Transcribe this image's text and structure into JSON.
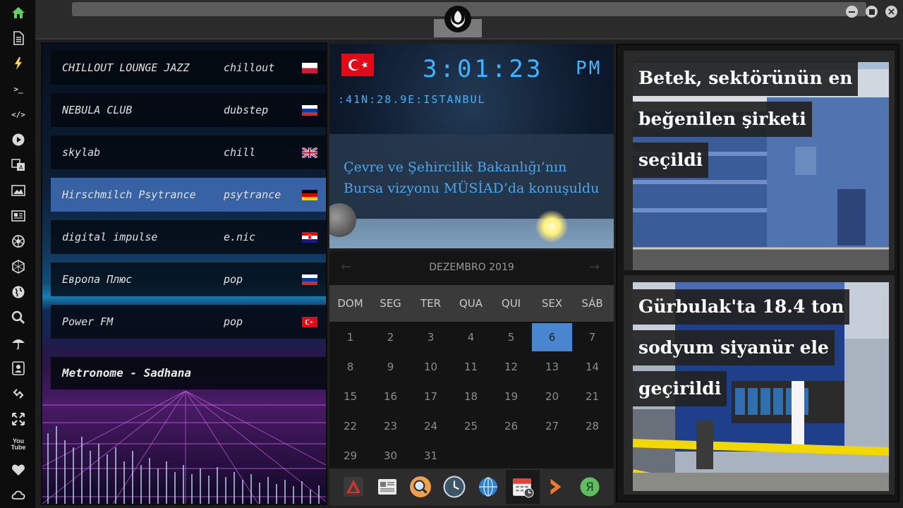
{
  "window": {
    "controls": [
      "minimize",
      "maximize",
      "close"
    ]
  },
  "rail": {
    "items": [
      {
        "name": "home",
        "icon": "home-icon"
      },
      {
        "name": "document",
        "icon": "document-icon"
      },
      {
        "name": "bolt",
        "icon": "bolt-icon"
      },
      {
        "name": "terminal",
        "icon": "terminal-icon",
        "glyph": ">_"
      },
      {
        "name": "code",
        "icon": "code-icon",
        "glyph": "</>"
      },
      {
        "name": "play",
        "icon": "play-icon"
      },
      {
        "name": "translate",
        "icon": "translate-icon"
      },
      {
        "name": "image",
        "icon": "image-icon"
      },
      {
        "name": "news",
        "icon": "newspaper-icon"
      },
      {
        "name": "aperture",
        "icon": "aperture-icon"
      },
      {
        "name": "hexagon",
        "icon": "hexagon-icon"
      },
      {
        "name": "globe",
        "icon": "globe-icon"
      },
      {
        "name": "search",
        "icon": "search-icon"
      },
      {
        "name": "weather",
        "icon": "umbrella-icon"
      },
      {
        "name": "contacts",
        "icon": "contact-icon"
      },
      {
        "name": "link",
        "icon": "link-icon"
      },
      {
        "name": "expand",
        "icon": "expand-icon"
      },
      {
        "name": "youtube",
        "icon": "youtube-icon",
        "glyph": "You Tube"
      },
      {
        "name": "favorites",
        "icon": "heart-icon"
      },
      {
        "name": "cloud",
        "icon": "cloud-icon"
      }
    ]
  },
  "radio": {
    "stations": [
      {
        "name": "CHILLOUT LOUNGE JAZZ",
        "genre": "chillout",
        "flag": "poland"
      },
      {
        "name": "NEBULA CLUB",
        "genre": "dubstep",
        "flag": "russia"
      },
      {
        "name": "skylab",
        "genre": "chill",
        "flag": "uk"
      },
      {
        "name": "Hirschmilch Psytrance",
        "genre": "psytrance",
        "flag": "germany"
      },
      {
        "name": "digital impulse",
        "genre": "e.nic",
        "flag": "croatia"
      },
      {
        "name": "Европа Плюс",
        "genre": "pop",
        "flag": "russia"
      },
      {
        "name": "Power FM",
        "genre": "pop",
        "flag": "turkey"
      }
    ],
    "active_index": 3,
    "now_playing": "Metronome - Sadhana"
  },
  "clock": {
    "time": "3:01:23",
    "ampm": "PM",
    "coordinates": ":41N:28.9E:ISTANBUL",
    "flag": "turkey",
    "headline": "Çevre ve Şehircilik Bakanlığı’nın Bursa vizyonu MÜSİAD’da konuşuldu"
  },
  "calendar": {
    "month_label": "DEZEMBRO 2019",
    "prev_label": "←",
    "next_label": "→",
    "weekdays": [
      "DOM",
      "SEG",
      "TER",
      "QUA",
      "QUI",
      "SEX",
      "SÁB"
    ],
    "weeks": [
      [
        "1",
        "2",
        "3",
        "4",
        "5",
        "6",
        "7"
      ],
      [
        "8",
        "9",
        "10",
        "11",
        "12",
        "13",
        "14"
      ],
      [
        "15",
        "16",
        "17",
        "18",
        "19",
        "20",
        "21"
      ],
      [
        "22",
        "23",
        "24",
        "25",
        "26",
        "27",
        "28"
      ],
      [
        "29",
        "30",
        "31"
      ]
    ],
    "today": "6"
  },
  "dock": {
    "items": [
      {
        "name": "app-launcher",
        "icon": "red-triangle-icon"
      },
      {
        "name": "news-reader",
        "icon": "newspaper-icon"
      },
      {
        "name": "search",
        "icon": "magnifier-icon"
      },
      {
        "name": "clock",
        "icon": "clock-icon"
      },
      {
        "name": "browser",
        "icon": "globe-icon"
      },
      {
        "name": "calendar",
        "icon": "calendar-icon"
      },
      {
        "name": "play",
        "icon": "orange-chevron-icon"
      },
      {
        "name": "yandex",
        "icon": "yandex-icon",
        "glyph": "Я"
      }
    ],
    "active_index": 5
  },
  "news": {
    "articles": [
      {
        "lines": [
          "Betek, sektörünün en",
          "beğenilen şirketi",
          "seçildi"
        ]
      },
      {
        "lines": [
          "Gürbulak'ta 18.4 ton",
          "sodyum siyanür ele",
          "geçirildi"
        ]
      }
    ]
  },
  "colors": {
    "clock_digits": "#3fb4ff",
    "headline": "#4da6ea",
    "today_cell": "#4a86d0",
    "active_station": "#4678c8"
  }
}
